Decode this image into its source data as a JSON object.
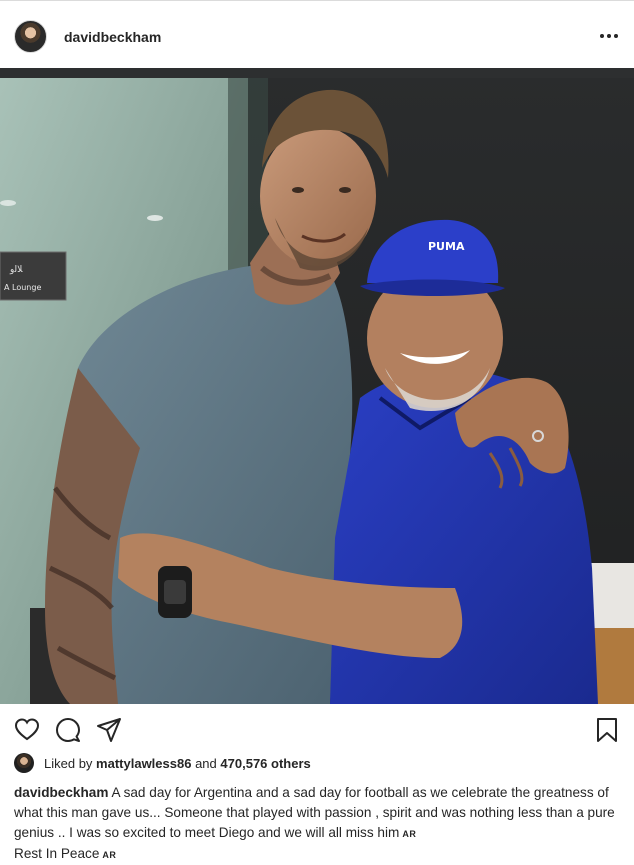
{
  "header": {
    "username": "davidbeckham",
    "avatar_icon": "profile-avatar-icon",
    "more_icon": "more-options-icon"
  },
  "photo": {
    "sign_text_top": "ﻼﻟﻭ",
    "sign_text_bottom": "A Lounge",
    "cap_logo": "PUMA"
  },
  "actions": {
    "like_icon": "heart-icon",
    "comment_icon": "comment-icon",
    "share_icon": "share-icon",
    "save_icon": "bookmark-icon"
  },
  "likes": {
    "prefix": "Liked by",
    "user": "mattylawless86",
    "middle": "and",
    "count": "470,576 others"
  },
  "caption": {
    "username": "davidbeckham",
    "text": "A sad day for Argentina and a sad day for football as we celebrate the greatness of what this man gave us... Someone that played with passion , spirit and was nothing less than a pure genius .. I was so excited to meet Diego and we will all miss him",
    "flag1": "AR",
    "line2": "Rest In Peace",
    "flag2": "AR"
  },
  "colors": {
    "text": "#262626",
    "border": "#dbdbdb",
    "background": "#ffffff"
  }
}
